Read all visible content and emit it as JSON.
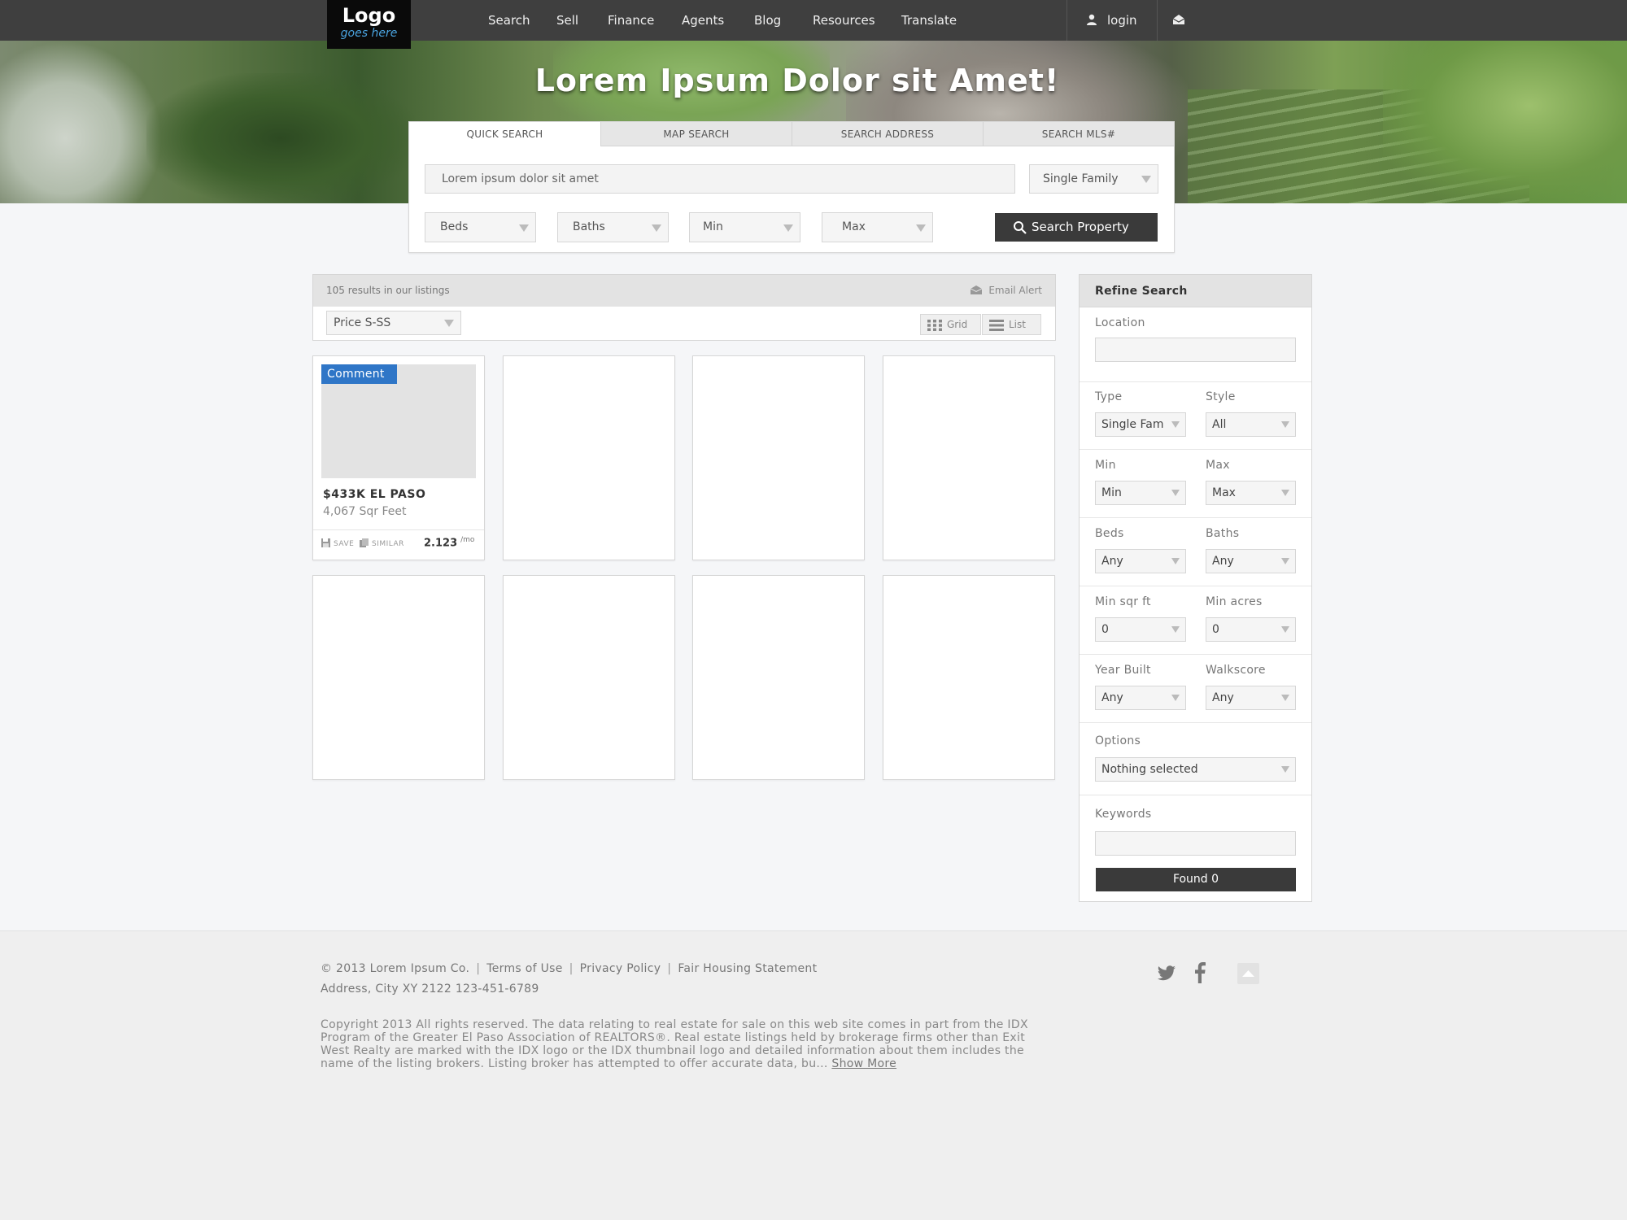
{
  "logo": {
    "line1": "Logo",
    "line2": "goes here"
  },
  "nav": {
    "items": [
      "Search",
      "Sell",
      "Finance",
      "Agents",
      "Blog",
      "Resources",
      "Translate"
    ],
    "login_label": "login",
    "icons": {
      "login": "user-icon",
      "mail": "envelope-icon"
    }
  },
  "hero": {
    "title": "Lorem Ipsum Dolor sit Amet!"
  },
  "search": {
    "tabs": [
      "QUICK SEARCH",
      "MAP SEARCH",
      "SEARCH ADDRESS",
      "SEARCH MLS#"
    ],
    "active_tab": "QUICK SEARCH",
    "query_placeholder": "Lorem ipsum dolor sit amet",
    "type_value": "Single Family",
    "beds_value": "Beds",
    "baths_value": "Baths",
    "min_value": "Min",
    "max_value": "Max",
    "button_label": "Search Property"
  },
  "results": {
    "count_text": "105 results in our listings",
    "email_alert": "Email Alert",
    "sort_value": "Price S-SS",
    "view_grid": "Grid",
    "view_list": "List"
  },
  "listing": {
    "badge": "Comment",
    "title": "$433K  EL PASO",
    "sqft": "4,067 Sqr Feet",
    "save": "SAVE",
    "similar": "SIMILAR",
    "price": "2.123",
    "price_unit": "/mo"
  },
  "refine": {
    "title": "Refine Search",
    "location_label": "Location",
    "type_label": "Type",
    "type_value": "Single Fam",
    "style_label": "Style",
    "style_value": "All",
    "min_label": "Min",
    "min_value": "Min",
    "max_label": "Max",
    "max_value": "Max",
    "beds_label": "Beds",
    "beds_value": "Any",
    "baths_label": "Baths",
    "baths_value": "Any",
    "sqft_label": "Min sqr ft",
    "sqft_value": "0",
    "acres_label": "Min acres",
    "acres_value": "0",
    "year_label": "Year Built",
    "year_value": "Any",
    "walk_label": "Walkscore",
    "walk_value": "Any",
    "options_label": "Options",
    "options_value": "Nothing selected",
    "keywords_label": "Keywords",
    "found_button": "Found 0"
  },
  "footer": {
    "copyright": "© 2013 Lorem Ipsum Co.",
    "terms": "Terms of Use",
    "privacy": "Privacy Policy",
    "fair": "Fair Housing Statement",
    "address": "Address, City  XY 2122  123-451-6789",
    "legal_text": "Copyright 2013   All rights reserved. The data relating to real estate for sale on this web site comes in part from the IDX Program of the Greater El Paso Association of REALTORS®. Real estate listings held by brokerage firms other than Exit West Realty are marked with the IDX logo or the IDX thumbnail logo and detailed information about them includes the name of the listing brokers. Listing broker has attempted to offer accurate data, bu...",
    "show_more": "Show More",
    "icons": [
      "twitter-icon",
      "facebook-icon",
      "back-to-top-icon"
    ]
  },
  "colors": {
    "nav_bg": "#3f3f3f",
    "badge": "#2f76c7",
    "button": "#3a3a3a",
    "logo_accent": "#4aa3df"
  }
}
